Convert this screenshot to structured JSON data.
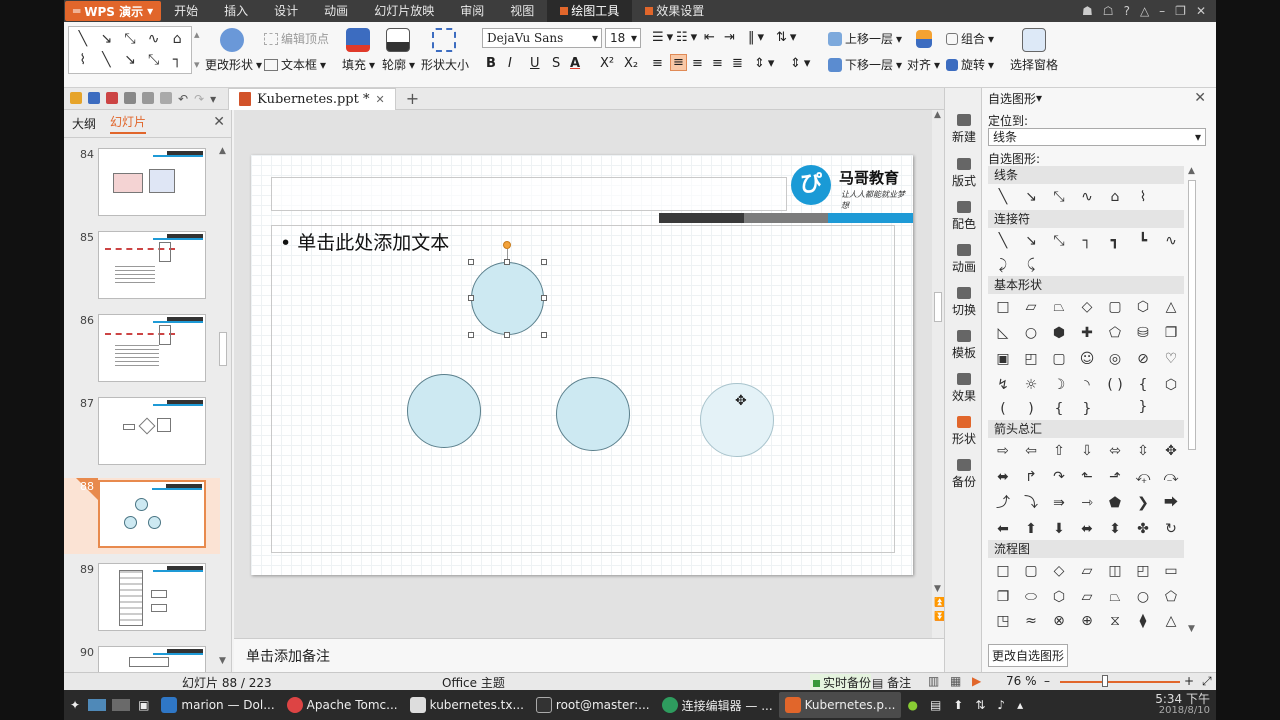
{
  "menubar": {
    "app": "WPS 演示",
    "items": [
      "开始",
      "插入",
      "设计",
      "动画",
      "幻灯片放映",
      "审阅",
      "视图",
      "绘图工具",
      "效果设置"
    ],
    "active": "绘图工具"
  },
  "ribbon": {
    "edit_points": "编辑顶点",
    "change_shape": "更改形状",
    "textbox": "文本框",
    "fill": "填充",
    "outline": "轮廓",
    "shape_size": "形状大小",
    "font": "DejaVu Sans",
    "size": "18",
    "bring_forward": "上移一层",
    "send_backward": "下移一层",
    "group": "组合",
    "align": "对齐",
    "rotate": "旋转",
    "selection_pane": "选择窗格"
  },
  "tabbar": {
    "doc_title": "Kubernetes.ppt *"
  },
  "leftpanel": {
    "tab_outline": "大纲",
    "tab_slides": "幻灯片",
    "slides": [
      {
        "num": "84"
      },
      {
        "num": "85"
      },
      {
        "num": "86"
      },
      {
        "num": "87"
      },
      {
        "num": "88",
        "selected": true
      },
      {
        "num": "89"
      },
      {
        "num": "90"
      }
    ]
  },
  "slide": {
    "body_placeholder": "单击此处添加文本",
    "logo_name": "马哥教育",
    "logo_slogan": "让人人都能就业梦想",
    "bar_colors": [
      "#3a3a3a",
      "#7c7c7c",
      "#1e9ad6"
    ],
    "circle_fill": "#cde9f2"
  },
  "notes": {
    "placeholder": "单击添加备注"
  },
  "taskicons": [
    "新建",
    "版式",
    "配色",
    "动画",
    "切换",
    "模板",
    "效果",
    "形状",
    "备份"
  ],
  "shapes_pane": {
    "title": "自选图形",
    "locate_label": "定位到:",
    "locate_value": "线条",
    "autoshape_label": "自选图形:",
    "groups": [
      "线条",
      "连接符",
      "基本形状",
      "箭头总汇",
      "流程图"
    ],
    "change_button": "更改自选图形"
  },
  "statusbar": {
    "slide_count": "幻灯片 88 / 223",
    "theme": "Office 主题",
    "backup": "实时备份",
    "notes": "备注",
    "zoom": "76 %"
  },
  "taskbar": {
    "apps": [
      "marion — Dol...",
      "Apache Tomc...",
      "kubernetes.tx...",
      "root@master:...",
      "连接编辑器 — ...",
      "Kubernetes.p..."
    ],
    "time": "5:34 下午",
    "date": "2018/8/10"
  }
}
